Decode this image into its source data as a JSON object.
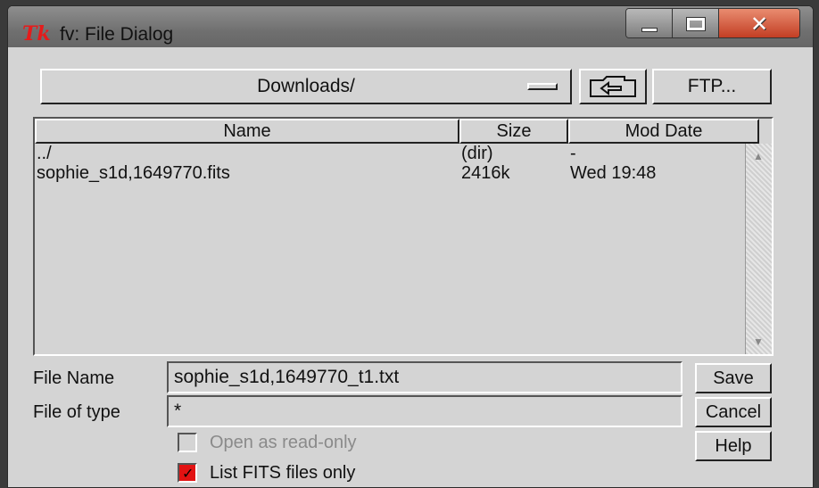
{
  "window": {
    "logo": "Tk",
    "title": "fv: File Dialog"
  },
  "directory": {
    "current": "Downloads/"
  },
  "buttons": {
    "ftp": "FTP...",
    "save": "Save",
    "cancel": "Cancel",
    "help": "Help"
  },
  "file_list": {
    "columns": [
      "Name",
      "Size",
      "Mod Date"
    ],
    "rows": [
      {
        "name": "../",
        "size": "(dir)",
        "date": "-"
      },
      {
        "name": "sophie_s1d,1649770.fits",
        "size": "2416k",
        "date": "Wed  19:48"
      }
    ]
  },
  "fields": {
    "file_name_label": "File Name",
    "file_name_value": "sophie_s1d,1649770_t1.txt",
    "file_type_label": "File of type",
    "file_type_value": "*"
  },
  "options": {
    "read_only_label": "Open as read-only",
    "read_only_checked": false,
    "fits_only_label": "List FITS files only",
    "fits_only_checked": true
  }
}
